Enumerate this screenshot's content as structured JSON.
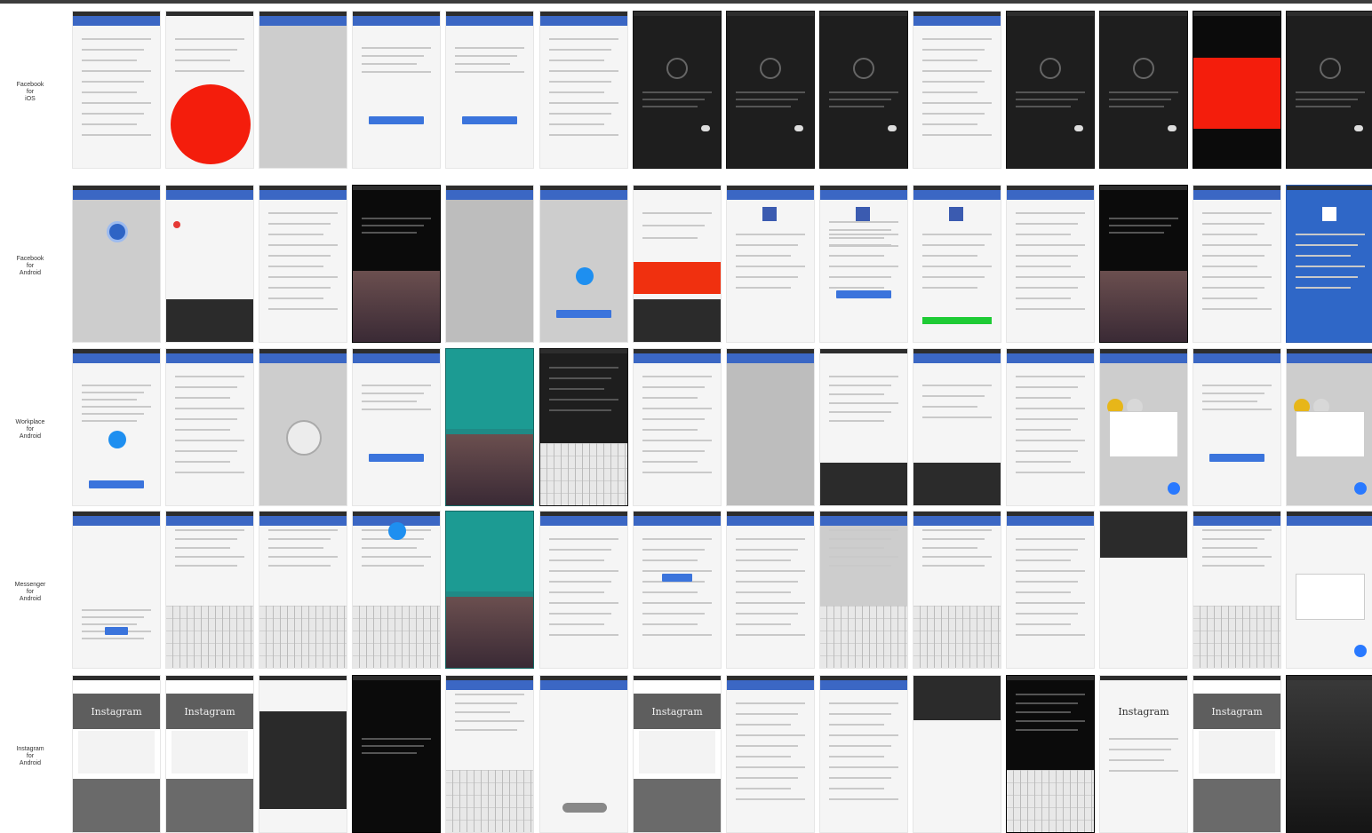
{
  "row_labels": [
    "Facebook\nfor\niOS",
    "Facebook\nfor\nAndroid",
    "Workplace\nfor\nAndroid",
    "Messenger\nfor\nAndroid",
    "Instagram\nfor\nAndroid"
  ],
  "rows": [
    {
      "name": "facebook-ios",
      "tiles": [
        "light",
        "red-circle",
        "gray",
        "light-form",
        "light-form",
        "light",
        "dark-spinner",
        "dark-spinner",
        "dark-spinner",
        "light-text",
        "dark-spinner",
        "dark-spinner",
        "red-rect",
        "dark-spinner"
      ]
    },
    {
      "name": "facebook-android",
      "tiles": [
        "gray-search",
        "light-keypad",
        "light-list",
        "black-wallpaper",
        "gray2",
        "gray-messenger",
        "red-box",
        "light-fb",
        "light-fb-form",
        "light-fb-green",
        "light-settings",
        "black-wallpaper",
        "light-list",
        "blue-fb"
      ]
    },
    {
      "name": "workplace-android",
      "tiles": [
        "light-messenger",
        "light-list",
        "gray-robot",
        "light-form",
        "teal-wall",
        "dark-notif",
        "light-list",
        "gray2",
        "dark-panel",
        "light-darkpanel",
        "light-list",
        "gray-dialog",
        "light-form",
        "gray-dialog"
      ]
    },
    {
      "name": "messenger-android",
      "tiles": [
        "light-welcome",
        "light-keyboard",
        "light-keyboard",
        "light-keyboard-msgr",
        "teal-wall",
        "light",
        "light-blue",
        "light-text",
        "gray-keyboard",
        "light-keyboard",
        "light-list",
        "dark-top",
        "light-keyboard",
        "light-dialog"
      ]
    },
    {
      "name": "instagram-android",
      "tiles": [
        "ig",
        "ig",
        "black-mid",
        "black",
        "light-keyboard",
        "light-pill",
        "ig",
        "light",
        "light",
        "light-dark-top",
        "black-keyboard",
        "light-ig",
        "ig",
        "dark-blur"
      ]
    }
  ],
  "instagram_logo": "Instagram"
}
